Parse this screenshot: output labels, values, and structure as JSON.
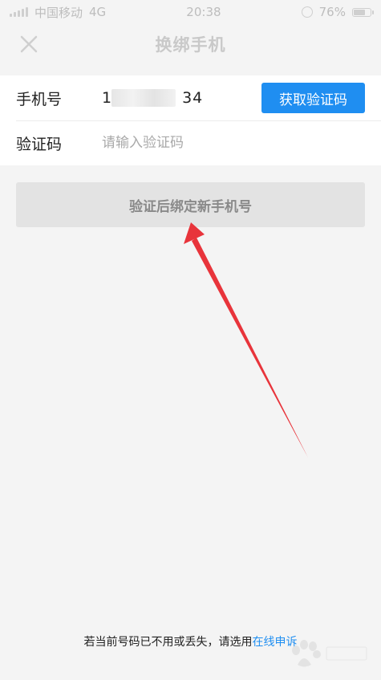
{
  "status_bar": {
    "carrier": "中国移动",
    "network": "4G",
    "time": "20:38",
    "battery": "76%",
    "battery_level": 0.76
  },
  "nav": {
    "title": "换绑手机",
    "close_icon": "close-icon"
  },
  "form": {
    "phone_label": "手机号",
    "phone_value_prefix": "1",
    "phone_value_suffix": "34",
    "get_code_button": "获取验证码",
    "code_label": "验证码",
    "code_placeholder": "请输入验证码",
    "code_value": ""
  },
  "submit_button": "验证后绑定新手机号",
  "footer": {
    "note": "若当前号码已不用或丢失，请选用",
    "link": "在线申诉"
  },
  "colors": {
    "accent": "#1f8ef1",
    "annotation_arrow": "#e8343b",
    "page_background": "#f4f4f4"
  }
}
